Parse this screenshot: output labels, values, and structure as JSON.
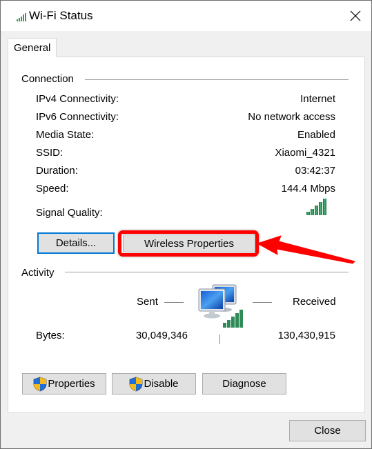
{
  "window": {
    "title": "Wi-Fi Status",
    "title_icon": "wifi-signal-icon",
    "close_icon": "close-icon"
  },
  "tabs": [
    {
      "label": "General",
      "active": true
    }
  ],
  "connection": {
    "group_label": "Connection",
    "rows": [
      {
        "label": "IPv4 Connectivity:",
        "value": "Internet"
      },
      {
        "label": "IPv6 Connectivity:",
        "value": "No network access"
      },
      {
        "label": "Media State:",
        "value": "Enabled"
      },
      {
        "label": "SSID:",
        "value": "Xiaomi_4321"
      },
      {
        "label": "Duration:",
        "value": "03:42:37"
      },
      {
        "label": "Speed:",
        "value": "144.4 Mbps"
      }
    ],
    "signal_quality": {
      "label": "Signal Quality:",
      "bars": 5,
      "max_bars": 5,
      "icon": "signal-bars-icon"
    },
    "buttons": {
      "details": "Details...",
      "wireless_properties": "Wireless Properties"
    }
  },
  "annotation": {
    "highlight_color": "#ff0000",
    "target": "wireless_properties"
  },
  "activity": {
    "group_label": "Activity",
    "sent_label": "Sent",
    "received_label": "Received",
    "bytes_label": "Bytes:",
    "bytes_sent": "30,049,346",
    "bytes_received": "130,430,915",
    "icon": "network-computers-icon"
  },
  "actions": {
    "properties": "Properties",
    "disable": "Disable",
    "diagnose": "Diagnose",
    "close": "Close"
  },
  "colors": {
    "focus_border": "#0078d7",
    "signal_green": "#2e8b57",
    "shield_blue": "#1e6fd9",
    "shield_yellow": "#f6b91b"
  }
}
